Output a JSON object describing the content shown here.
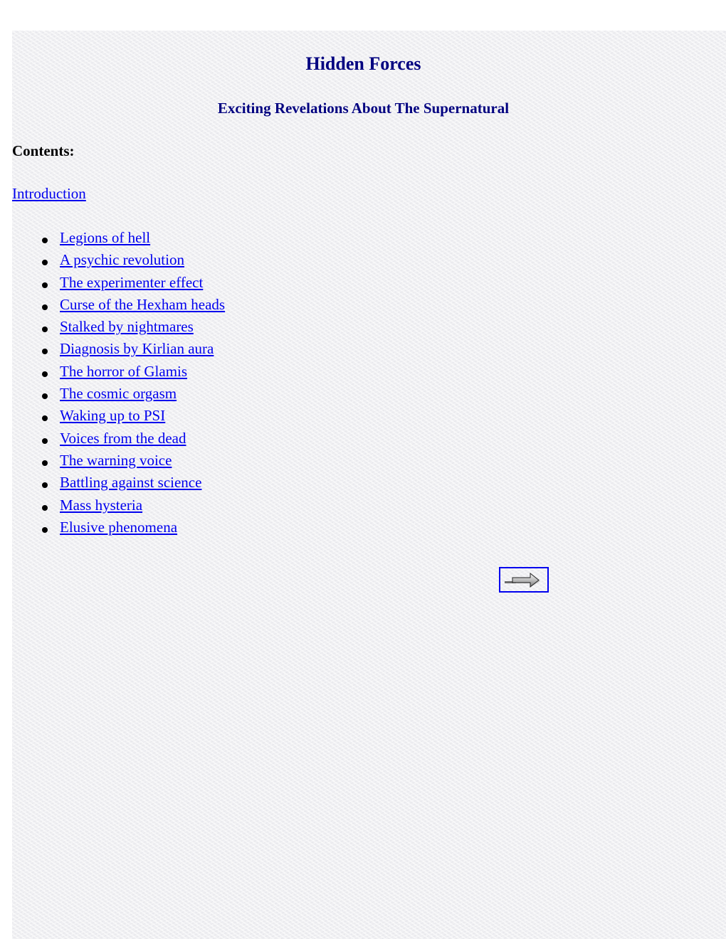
{
  "header": {
    "title": "Hidden Forces",
    "subtitle": "Exciting Revelations About The Supernatural"
  },
  "contents": {
    "heading": "Contents:",
    "intro_link": "Introduction",
    "items": [
      {
        "label": "Legions of hell"
      },
      {
        "label": "A psychic revolution"
      },
      {
        "label": "The experimenter effect"
      },
      {
        "label": "Curse of the Hexham heads"
      },
      {
        "label": "Stalked by nightmares"
      },
      {
        "label": "Diagnosis by Kirlian aura"
      },
      {
        "label": "The horror of Glamis"
      },
      {
        "label": "The cosmic orgasm"
      },
      {
        "label": "Waking up to PSI"
      },
      {
        "label": "Voices from the dead"
      },
      {
        "label": "The warning voice"
      },
      {
        "label": "Battling against science"
      },
      {
        "label": "Mass hysteria"
      },
      {
        "label": "Elusive phenomena"
      }
    ]
  },
  "navigation": {
    "next_icon": "right-arrow-icon"
  },
  "colors": {
    "heading": "#000080",
    "link": "#0000ee",
    "text": "#000000"
  }
}
